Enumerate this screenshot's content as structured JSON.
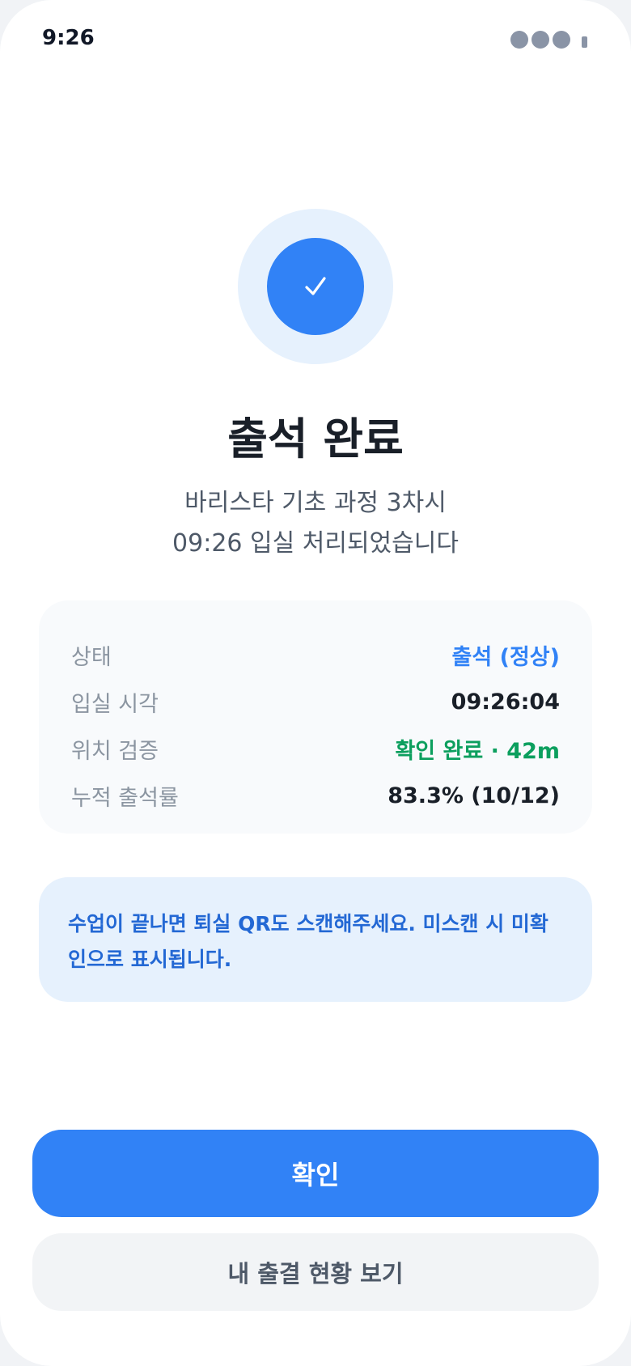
{
  "status_bar": {
    "time": "9:26"
  },
  "result": {
    "icon": "check-icon",
    "title": "출석 완료",
    "subtitle_line1": "바리스타 기초 과정 3차시",
    "subtitle_line2": "09:26 입실 처리되었습니다"
  },
  "details": [
    {
      "label": "상태",
      "value": "출석 (정상)",
      "color": "#3182f6"
    },
    {
      "label": "입실 시각",
      "value": "09:26:04",
      "color": "#191f28"
    },
    {
      "label": "위치 검증",
      "value": "확인 완료 · 42m",
      "color": "#0c9f5e"
    },
    {
      "label": "누적 출석률",
      "value": "83.3% (10/12)",
      "color": "#191f28"
    }
  ],
  "notice": {
    "line1": "수업이 끝나면 퇴실 QR도 스캔해주세요. 미스캔 시 미확",
    "line2": "인으로 표시됩니다."
  },
  "buttons": {
    "confirm": "확인",
    "view_attendance": "내 출결 현황 보기"
  },
  "colors": {
    "accent": "#3182f6",
    "success": "#0c9f5e",
    "notice_bg": "#e6f1fd"
  }
}
